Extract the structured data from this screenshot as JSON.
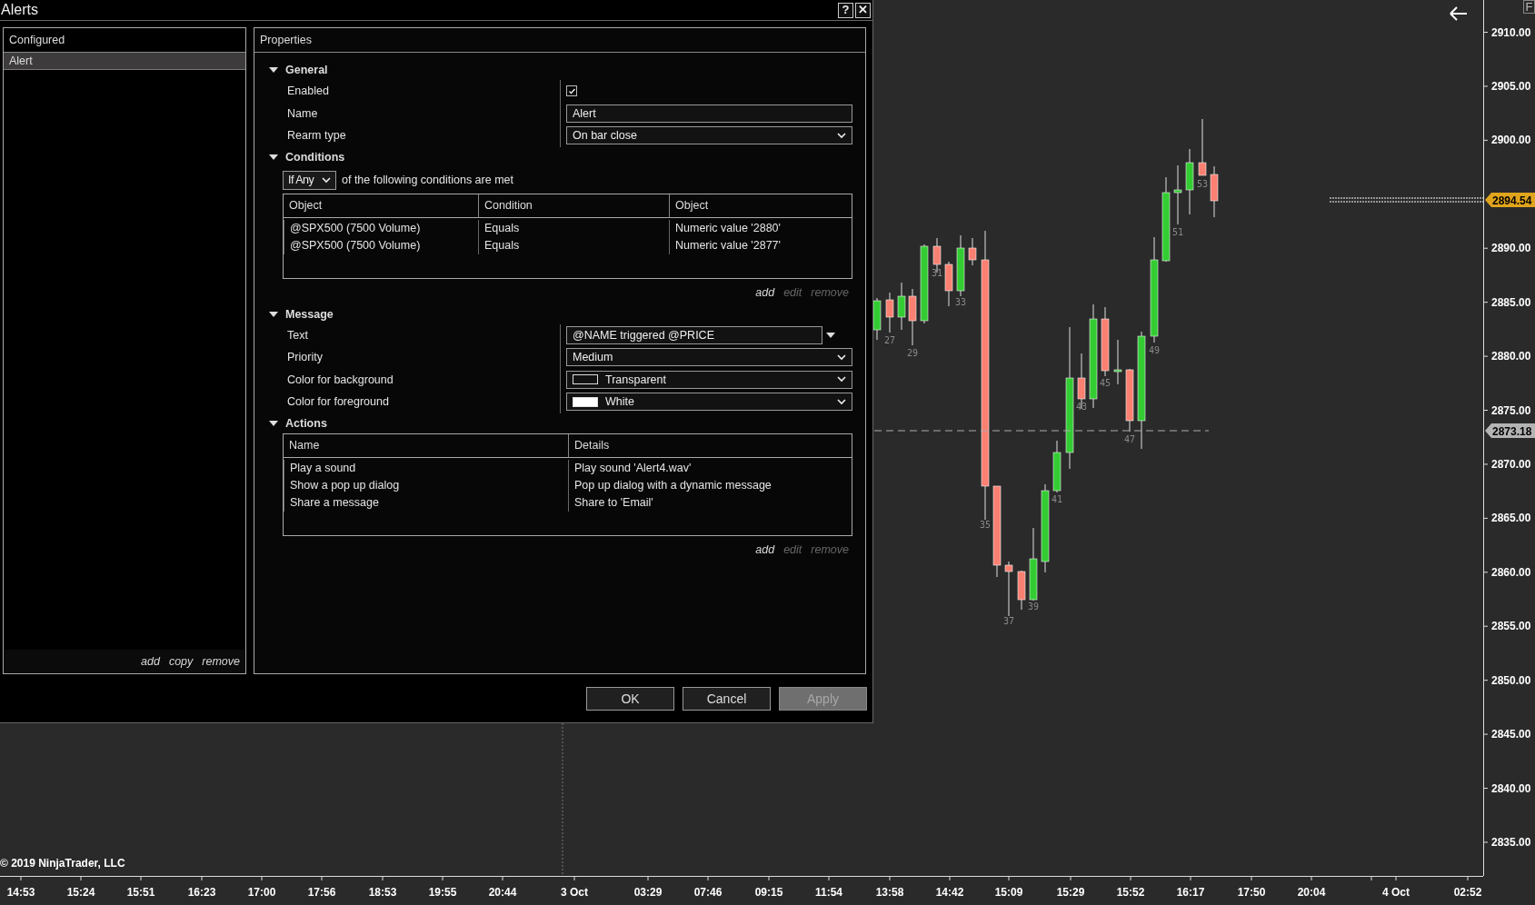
{
  "window": {
    "title": "Alerts",
    "help_button": "?",
    "close_button": "✕"
  },
  "configured": {
    "title": "Configured",
    "items": [
      {
        "label": "Alert",
        "selected": true
      }
    ],
    "links": [
      {
        "label": "add",
        "disabled": false
      },
      {
        "label": "copy",
        "disabled": false
      },
      {
        "label": "remove",
        "disabled": false
      }
    ]
  },
  "properties": {
    "title": "Properties",
    "general": {
      "title": "General",
      "expanded": true,
      "enabled": {
        "label": "Enabled",
        "checked": true
      },
      "name": {
        "label": "Name",
        "value": "Alert"
      },
      "rearm_type": {
        "label": "Rearm type",
        "value": "On bar close"
      }
    },
    "conditions": {
      "title": "Conditions",
      "expanded": true,
      "mode": "If Any",
      "mode_text": "of the following conditions are met",
      "columns": [
        "Object",
        "Condition",
        "Object"
      ],
      "rows": [
        [
          "@SPX500 (7500 Volume)",
          "Equals",
          "Numeric value '2880'"
        ],
        [
          "@SPX500 (7500 Volume)",
          "Equals",
          "Numeric value '2877'"
        ]
      ],
      "links": [
        {
          "label": "add",
          "disabled": false
        },
        {
          "label": "edit",
          "disabled": true
        },
        {
          "label": "remove",
          "disabled": true
        }
      ]
    },
    "message": {
      "title": "Message",
      "expanded": true,
      "fields": [
        {
          "kind": "combo",
          "label": "Text",
          "value": "@NAME triggered @PRICE"
        },
        {
          "kind": "dropdown",
          "label": "Priority",
          "value": "Medium"
        },
        {
          "kind": "color",
          "label": "Color for background",
          "value": "Transparent"
        },
        {
          "kind": "color",
          "label": "Color for foreground",
          "value": "White",
          "color": "#ffffff"
        }
      ]
    },
    "actions": {
      "title": "Actions",
      "expanded": true,
      "columns": [
        "Name",
        "Details"
      ],
      "rows": [
        [
          "Play a sound",
          "Play sound 'Alert4.wav'"
        ],
        [
          "Show a pop up dialog",
          "Pop up dialog with a dynamic message"
        ],
        [
          "Share a message",
          "Share to 'Email'"
        ]
      ],
      "links": [
        {
          "label": "add",
          "disabled": false
        },
        {
          "label": "edit",
          "disabled": true
        },
        {
          "label": "remove",
          "disabled": true
        }
      ]
    }
  },
  "buttons": [
    {
      "label": "OK",
      "disabled": false
    },
    {
      "label": "Cancel",
      "disabled": false
    },
    {
      "label": "Apply",
      "disabled": true
    }
  ],
  "chart": {
    "panel_button": "F",
    "copyright": "© 2019 NinjaTrader, LLC",
    "price_labels": [
      "2910.00",
      "2905.00",
      "2900.00",
      "2890.00",
      "2885.00",
      "2880.00",
      "2875.00",
      "2870.00",
      "2865.00",
      "2860.00",
      "2855.00",
      "2850.00",
      "2845.00",
      "2840.00",
      "2835.00"
    ],
    "last_price": "2894.54",
    "line_price": "2873.18",
    "bar_labels": [
      "27",
      "29",
      "31",
      "33",
      "35",
      "37",
      "39",
      "41",
      "43",
      "45",
      "47",
      "49",
      "51",
      "53"
    ],
    "time_labels": [
      "14:53",
      "15:24",
      "15:51",
      "16:23",
      "17:00",
      "17:56",
      "18:53",
      "19:55",
      "20:44",
      "3 Oct",
      "03:29",
      "07:46",
      "09:15",
      "11:54",
      "13:58",
      "14:42",
      "15:09",
      "15:29",
      "15:52",
      "16:17",
      "17:50",
      "20:04",
      "4 Oct",
      "02:52"
    ]
  }
}
